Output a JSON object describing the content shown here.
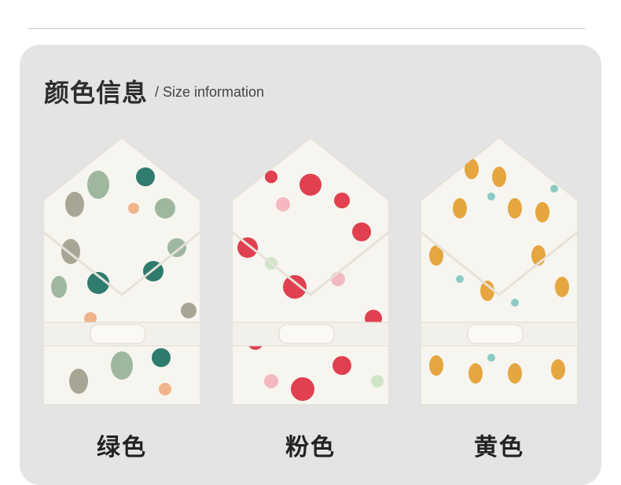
{
  "header": {
    "title": "颜色信息",
    "subtitle": "/  Size information"
  },
  "products": [
    {
      "label": "绿色",
      "pattern": "green-trees-fruit",
      "accent": "#6f9a85"
    },
    {
      "label": "粉色",
      "pattern": "pink-red-flowers",
      "accent": "#e0404f"
    },
    {
      "label": "黄色",
      "pattern": "yellow-pears",
      "accent": "#e5a640"
    }
  ],
  "colors": {
    "background": "#ffffff",
    "card": "#e4e4e4",
    "fabric": "#f7f5f0"
  }
}
